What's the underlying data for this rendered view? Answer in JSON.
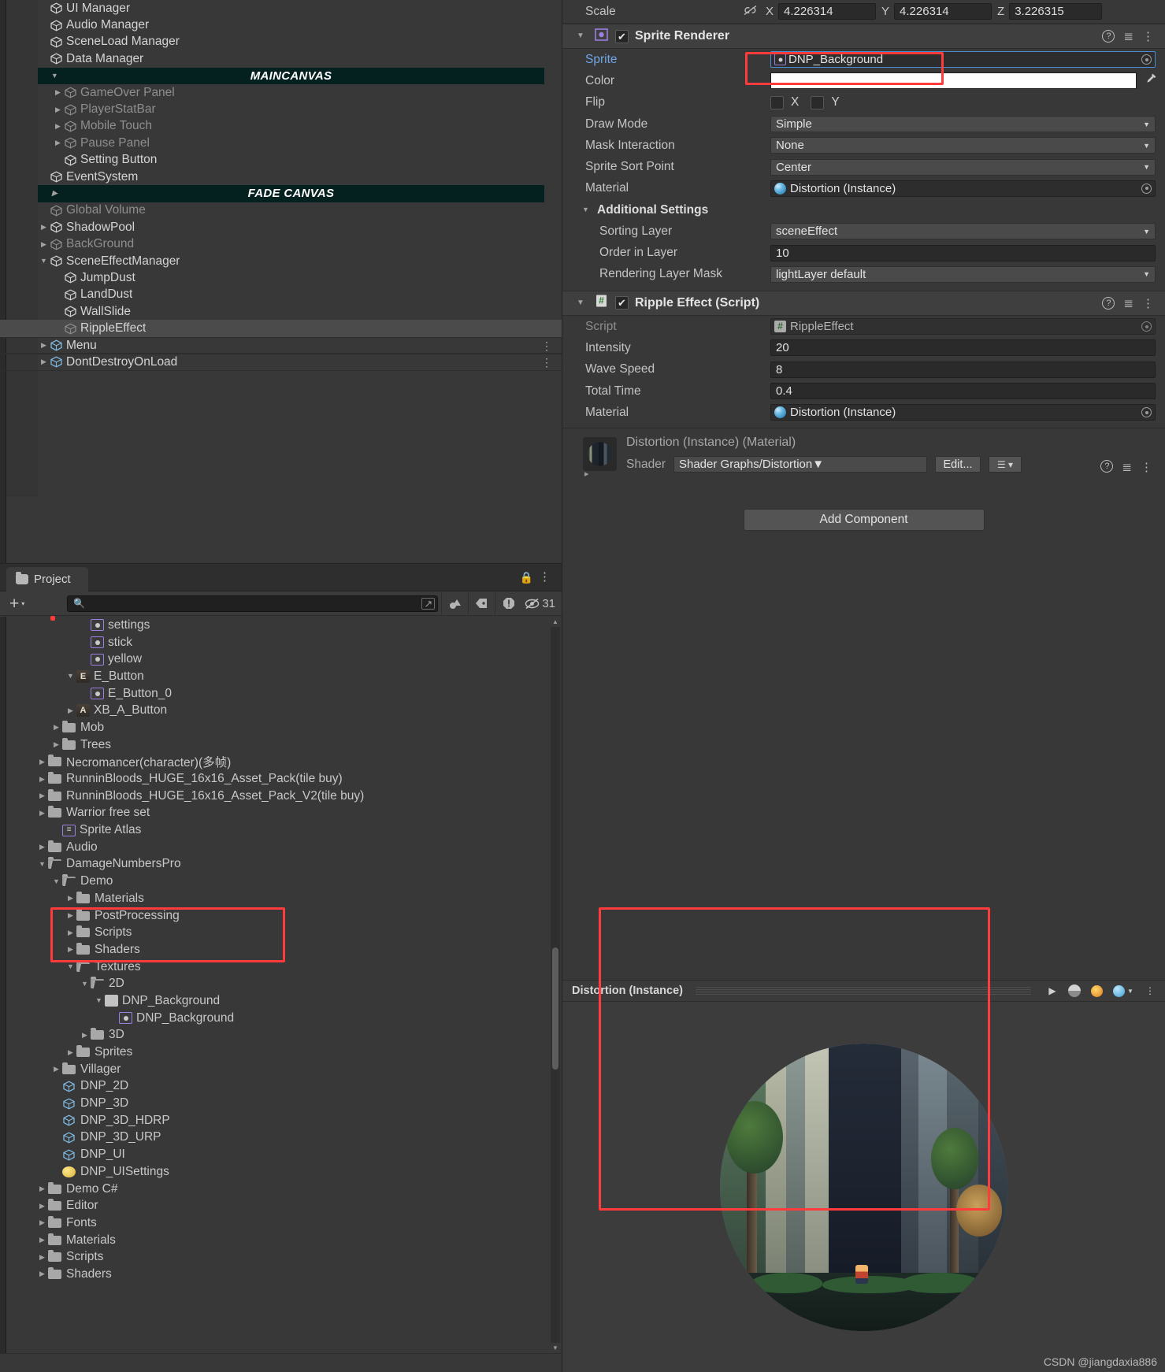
{
  "hierarchy": {
    "items": [
      {
        "label": "UI Manager",
        "indent": 1,
        "tri": "none",
        "state": "norm",
        "icon": "gameobject-icon",
        "clipped": true
      },
      {
        "label": "Audio Manager",
        "indent": 1,
        "tri": "none",
        "state": "norm",
        "icon": "gameobject-icon"
      },
      {
        "label": "SceneLoad Manager",
        "indent": 1,
        "tri": "none",
        "state": "norm",
        "icon": "gameobject-icon"
      },
      {
        "label": "Data Manager",
        "indent": 1,
        "tri": "none",
        "state": "norm",
        "icon": "gameobject-icon"
      },
      {
        "label": "MAINCANVAS",
        "indent": 1,
        "tri": "down",
        "state": "header",
        "icon": "none"
      },
      {
        "label": "GameOver Panel",
        "indent": 2,
        "tri": "right",
        "state": "dim",
        "icon": "gameobject-icon"
      },
      {
        "label": "PlayerStatBar",
        "indent": 2,
        "tri": "right",
        "state": "dim",
        "icon": "gameobject-icon"
      },
      {
        "label": "Mobile Touch",
        "indent": 2,
        "tri": "right",
        "state": "dim",
        "icon": "gameobject-icon"
      },
      {
        "label": "Pause Panel",
        "indent": 2,
        "tri": "right",
        "state": "dim",
        "icon": "gameobject-icon"
      },
      {
        "label": "Setting Button",
        "indent": 2,
        "tri": "none",
        "state": "norm",
        "icon": "gameobject-icon"
      },
      {
        "label": "EventSystem",
        "indent": 1,
        "tri": "none",
        "state": "norm",
        "icon": "gameobject-icon"
      },
      {
        "label": "FADE CANVAS",
        "indent": 1,
        "tri": "right",
        "state": "header",
        "icon": "none"
      },
      {
        "label": "Global Volume",
        "indent": 1,
        "tri": "none",
        "state": "dim",
        "icon": "gameobject-icon"
      },
      {
        "label": "ShadowPool",
        "indent": 1,
        "tri": "right",
        "state": "norm",
        "icon": "gameobject-icon"
      },
      {
        "label": "BackGround",
        "indent": 1,
        "tri": "right",
        "state": "dim",
        "icon": "gameobject-icon"
      },
      {
        "label": "SceneEffectManager",
        "indent": 1,
        "tri": "down",
        "state": "norm",
        "icon": "gameobject-icon"
      },
      {
        "label": "JumpDust",
        "indent": 2,
        "tri": "none",
        "state": "norm",
        "icon": "gameobject-icon"
      },
      {
        "label": "LandDust",
        "indent": 2,
        "tri": "none",
        "state": "norm",
        "icon": "gameobject-icon"
      },
      {
        "label": "WallSlide",
        "indent": 2,
        "tri": "none",
        "state": "norm",
        "icon": "gameobject-icon"
      },
      {
        "label": "RippleEffect",
        "indent": 2,
        "tri": "none",
        "state": "selected",
        "icon": "gameobject-icon"
      },
      {
        "label": "Menu",
        "indent": 1,
        "tri": "right",
        "state": "norm",
        "icon": "prefab-icon",
        "kebab": "⋮",
        "divider": true
      },
      {
        "label": "DontDestroyOnLoad",
        "indent": 1,
        "tri": "right",
        "state": "norm",
        "icon": "prefab-icon",
        "kebab": "⋮",
        "divider": true
      }
    ]
  },
  "project": {
    "tab_label": "Project",
    "create_button_label": "+",
    "create_button_caret": "▾",
    "search": {
      "value": "",
      "placeholder": ""
    },
    "search_icon": "search-icon",
    "save_search_icon": "open-in-new-icon",
    "filter_type_icon": "filter-by-type-icon",
    "filter_label_icon": "filter-by-label-icon",
    "warning_icon": "warning-filter-icon",
    "hidden_icon": "eye-slash-icon",
    "hidden_count": "31",
    "lock_icon": "lock-icon",
    "kebab_icon": "⋮",
    "tree": [
      {
        "label": "settings",
        "indent": 3,
        "tri": "none",
        "icon": "sprite-icon",
        "clipped": true
      },
      {
        "label": "stick",
        "indent": 3,
        "tri": "none",
        "icon": "sprite-icon"
      },
      {
        "label": "yellow",
        "indent": 3,
        "tri": "none",
        "icon": "sprite-icon"
      },
      {
        "label": "E_Button",
        "indent": 2,
        "tri": "down",
        "icon": "letter-e-icon"
      },
      {
        "label": "E_Button_0",
        "indent": 3,
        "tri": "none",
        "icon": "sprite-icon"
      },
      {
        "label": "XB_A_Button",
        "indent": 2,
        "tri": "right",
        "icon": "letter-a-icon"
      },
      {
        "label": "Mob",
        "indent": 1,
        "tri": "right",
        "icon": "folder-icon"
      },
      {
        "label": "Trees",
        "indent": 1,
        "tri": "right",
        "icon": "folder-icon"
      },
      {
        "label": "Necromancer(character)(多帧)",
        "indent": 0,
        "tri": "right",
        "icon": "folder-icon"
      },
      {
        "label": "RunninBloods_HUGE_16x16_Asset_Pack(tile  buy)",
        "indent": 0,
        "tri": "right",
        "icon": "folder-icon"
      },
      {
        "label": "RunninBloods_HUGE_16x16_Asset_Pack_V2(tile  buy)",
        "indent": 0,
        "tri": "right",
        "icon": "folder-icon"
      },
      {
        "label": "Warrior free set",
        "indent": 0,
        "tri": "right",
        "icon": "folder-icon"
      },
      {
        "label": "Sprite Atlas",
        "indent": 1,
        "tri": "none",
        "icon": "sprite-atlas-icon"
      },
      {
        "label": "Audio",
        "indent": 0,
        "tri": "right",
        "icon": "folder-icon"
      },
      {
        "label": "DamageNumbersPro",
        "indent": 0,
        "tri": "down",
        "icon": "folder-open-icon"
      },
      {
        "label": "Demo",
        "indent": 1,
        "tri": "down",
        "icon": "folder-open-icon"
      },
      {
        "label": "Materials",
        "indent": 2,
        "tri": "right",
        "icon": "folder-icon"
      },
      {
        "label": "PostProcessing",
        "indent": 2,
        "tri": "right",
        "icon": "folder-icon"
      },
      {
        "label": "Scripts",
        "indent": 2,
        "tri": "right",
        "icon": "folder-icon"
      },
      {
        "label": "Shaders",
        "indent": 2,
        "tri": "right",
        "icon": "folder-icon"
      },
      {
        "label": "Textures",
        "indent": 2,
        "tri": "down",
        "icon": "folder-open-icon"
      },
      {
        "label": "2D",
        "indent": 3,
        "tri": "down",
        "icon": "folder-open-icon"
      },
      {
        "label": "DNP_Background",
        "indent": 4,
        "tri": "down",
        "icon": "texture-icon"
      },
      {
        "label": "DNP_Background",
        "indent": 5,
        "tri": "none",
        "icon": "sprite-icon"
      },
      {
        "label": "3D",
        "indent": 3,
        "tri": "right",
        "icon": "folder-icon"
      },
      {
        "label": "Sprites",
        "indent": 2,
        "tri": "right",
        "icon": "folder-icon"
      },
      {
        "label": "Villager",
        "indent": 1,
        "tri": "right",
        "icon": "folder-icon"
      },
      {
        "label": "DNP_2D",
        "indent": 1,
        "tri": "none",
        "icon": "prefab-icon"
      },
      {
        "label": "DNP_3D",
        "indent": 1,
        "tri": "none",
        "icon": "prefab-icon"
      },
      {
        "label": "DNP_3D_HDRP",
        "indent": 1,
        "tri": "none",
        "icon": "prefab-icon"
      },
      {
        "label": "DNP_3D_URP",
        "indent": 1,
        "tri": "none",
        "icon": "prefab-icon"
      },
      {
        "label": "DNP_UI",
        "indent": 1,
        "tri": "none",
        "icon": "prefab-icon"
      },
      {
        "label": "DNP_UISettings",
        "indent": 1,
        "tri": "none",
        "icon": "settings-asset-icon"
      },
      {
        "label": "Demo C#",
        "indent": 0,
        "tri": "right",
        "icon": "folder-icon"
      },
      {
        "label": "Editor",
        "indent": 0,
        "tri": "right",
        "icon": "folder-icon"
      },
      {
        "label": "Fonts",
        "indent": 0,
        "tri": "right",
        "icon": "folder-icon"
      },
      {
        "label": "Materials",
        "indent": 0,
        "tri": "right",
        "icon": "folder-icon"
      },
      {
        "label": "Scripts",
        "indent": 0,
        "tri": "right",
        "icon": "folder-icon"
      },
      {
        "label": "Shaders",
        "indent": 0,
        "tri": "right",
        "icon": "folder-icon"
      }
    ]
  },
  "inspector": {
    "transform": {
      "scale_label": "Scale",
      "link_icon": "constrain-proportions-off-icon",
      "axes": [
        {
          "label": "X",
          "value": "4.226314"
        },
        {
          "label": "Y",
          "value": "4.226314"
        },
        {
          "label": "Z",
          "value": "3.226315"
        }
      ]
    },
    "sprite_renderer": {
      "title": "Sprite Renderer",
      "enabled_check": "✔",
      "component_icon": "sprite-renderer-icon",
      "help_icon": "help-icon",
      "preset_icon": "preset-icon",
      "kebab_icon": "⋮",
      "fields": [
        {
          "label": "Sprite",
          "value": "DNP_Background",
          "type": "object",
          "highlight": true
        },
        {
          "label": "Color",
          "value": "",
          "type": "color",
          "color": "#ffffff"
        },
        {
          "label": "Flip",
          "value": "",
          "type": "flip",
          "x_label": "X",
          "y_label": "Y"
        },
        {
          "label": "Draw Mode",
          "value": "Simple",
          "type": "dropdown"
        },
        {
          "label": "Mask Interaction",
          "value": "None",
          "type": "dropdown"
        },
        {
          "label": "Sprite Sort Point",
          "value": "Center",
          "type": "dropdown"
        },
        {
          "label": "Material",
          "value": "Distortion (Instance)",
          "type": "material"
        }
      ],
      "additional_settings": {
        "label": "Additional Settings",
        "fields": [
          {
            "label": "Sorting Layer",
            "value": "sceneEffect",
            "type": "dropdown"
          },
          {
            "label": "Order in Layer",
            "value": "10",
            "type": "text"
          },
          {
            "label": "Rendering Layer Mask",
            "value": "lightLayer default",
            "type": "dropdown"
          }
        ]
      }
    },
    "ripple_effect": {
      "title": "Ripple Effect (Script)",
      "enabled_check": "✔",
      "component_icon": "cs-script-icon",
      "help_icon": "help-icon",
      "preset_icon": "preset-icon",
      "kebab_icon": "⋮",
      "fields": [
        {
          "label": "Script",
          "value": "RippleEffect",
          "type": "script",
          "disabled": true
        },
        {
          "label": "Intensity",
          "value": "20",
          "type": "text"
        },
        {
          "label": "Wave Speed",
          "value": "8",
          "type": "text"
        },
        {
          "label": "Total Time",
          "value": "0.4",
          "type": "text"
        },
        {
          "label": "Material",
          "value": "Distortion (Instance)",
          "type": "material"
        }
      ]
    },
    "material_block": {
      "title": "Distortion (Instance) (Material)",
      "thumbnail_icon": "material-preview-icon",
      "shader_label": "Shader",
      "shader_value": "Shader Graphs/Distortion",
      "edit_button": "Edit...",
      "list_icon": "shader-dropdown-icon",
      "help_icon": "help-icon",
      "preset_icon": "preset-icon",
      "kebab_icon": "⋮",
      "expand_tri": "▸"
    },
    "add_component_label": "Add Component"
  },
  "preview": {
    "title": "Distortion (Instance)",
    "play_icon": "play-icon",
    "sphere_icon": "preview-mesh-icon",
    "light_icon": "preview-lighting-icon",
    "blue_icon": "preview-environment-icon",
    "caret_icon": "▾",
    "kebab_icon": "⋮",
    "artwork_icon": "material-preview-sphere"
  },
  "watermark": "CSDN @jiangdaxia886",
  "colors": {
    "panel_bg": "#383838",
    "header_bg": "#3f3f3f",
    "canvas_header": "#04201f",
    "selection": "#4b4b4b",
    "accent_blue": "#70a6e8",
    "highlight_red": "#ff3b3b",
    "field_dark": "#2a2a2a",
    "field_light": "#4a4a4a"
  }
}
